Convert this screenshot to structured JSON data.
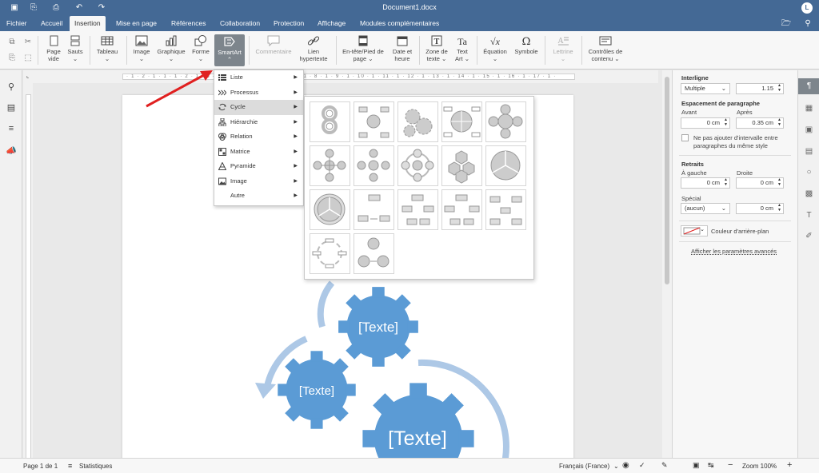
{
  "app": {
    "doc_title": "Document1.docx",
    "user_initial": "L"
  },
  "tabs": [
    {
      "label": "Fichier"
    },
    {
      "label": "Accueil"
    },
    {
      "label": "Insertion"
    },
    {
      "label": "Mise en page"
    },
    {
      "label": "Références"
    },
    {
      "label": "Collaboration"
    },
    {
      "label": "Protection"
    },
    {
      "label": "Affichage"
    },
    {
      "label": "Modules complémentaires"
    }
  ],
  "toolbar": {
    "page_vide": [
      "Page",
      "vide"
    ],
    "sauts": "Sauts",
    "tableau": "Tableau",
    "image": "Image",
    "graphique": "Graphique",
    "forme": "Forme",
    "smartart": "SmartArt",
    "commentaire": "Commentaire",
    "lien": [
      "Lien",
      "hypertexte"
    ],
    "entete": [
      "En-tête/Pied de",
      "page"
    ],
    "date": [
      "Date et",
      "heure"
    ],
    "zone": [
      "Zone de",
      "texte"
    ],
    "textart": [
      "Text",
      "Art"
    ],
    "equation": "Équation",
    "symbole": "Symbole",
    "lettrine": "Lettrine",
    "controles": [
      "Contrôles de",
      "contenu"
    ]
  },
  "ruler_marks": "· 1 · 2 · 1 · 1 · 1 · 2 · 1 · 3 · 1 · 4 · 1 · 5 · 1 · 6 · 1 · 7 · 1 · 8 · 1 · 9 · 1 · 10 · 1 · 11 · 1 · 12 · 1 · 13 · 1 · 14 · 1 · 15 · 1 · 16 · 1 · 17 · 1 ·",
  "smartart_menu": [
    {
      "label": "Liste",
      "icon": "list-icon"
    },
    {
      "label": "Processus",
      "icon": "process-icon"
    },
    {
      "label": "Cycle",
      "icon": "cycle-icon"
    },
    {
      "label": "Hiérarchie",
      "icon": "hierarchy-icon"
    },
    {
      "label": "Relation",
      "icon": "relation-icon"
    },
    {
      "label": "Matrice",
      "icon": "matrix-icon"
    },
    {
      "label": "Pyramide",
      "icon": "pyramid-icon"
    },
    {
      "label": "Image",
      "icon": "picture-icon"
    },
    {
      "label": "Autre",
      "icon": ""
    }
  ],
  "gallery_count": 17,
  "diagram": {
    "gear_text": "[Texte]"
  },
  "right_panel": {
    "interligne": "Interligne",
    "interligne_type": "Multiple",
    "interligne_value": "1.15",
    "espacement": "Espacement de paragraphe",
    "avant": "Avant",
    "apres": "Après",
    "avant_value": "0 cm",
    "apres_value": "0.35 cm",
    "checkbox_label": [
      "Ne pas ajouter d'intervalle entre",
      "paragraphes du même style"
    ],
    "retraits": "Retraits",
    "a_gauche": "À gauche",
    "droite": "Droite",
    "gauche_value": "0 cm",
    "droite_value": "0 cm",
    "special": "Spécial",
    "special_value": "(aucun)",
    "special_indent": "0 cm",
    "bg_color": "Couleur d'arrière-plan",
    "advanced": "Afficher les paramètres avancés"
  },
  "status": {
    "page": "Page 1 de 1",
    "stats": "Statistiques",
    "language": "Français (France)",
    "zoom": "Zoom 100%"
  },
  "colors": {
    "header": "#446995",
    "gear": "#5b9bd5",
    "arrow": "#adc8e6",
    "red_arrow": "#e02020"
  }
}
